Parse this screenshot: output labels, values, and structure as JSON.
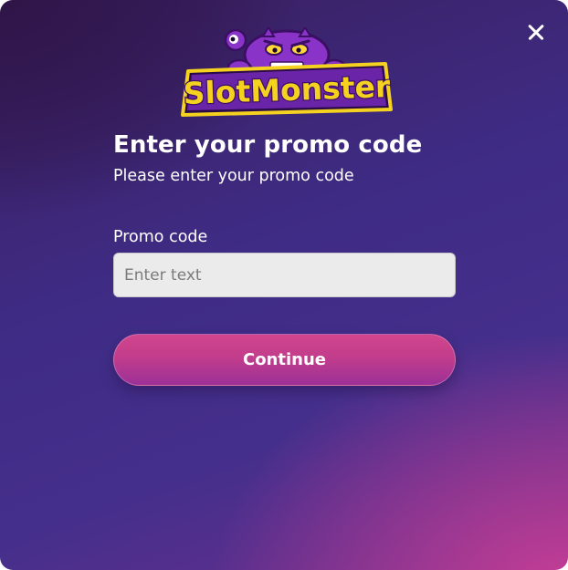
{
  "modal": {
    "logo_text": "SlotMonster",
    "title": "Enter your promo code",
    "subtitle": "Please enter your promo code",
    "field_label": "Promo code",
    "input_placeholder": "Enter text",
    "input_value": "",
    "continue_label": "Continue",
    "close_icon": "close-icon"
  },
  "colors": {
    "background_top": "#3a1f5e",
    "background_mid": "#3f2c86",
    "background_accent": "#d64096",
    "button": "#c23d8c",
    "input_bg": "#ebebeb",
    "logo_yellow": "#f5d21f",
    "logo_purple": "#7e2fc0"
  }
}
